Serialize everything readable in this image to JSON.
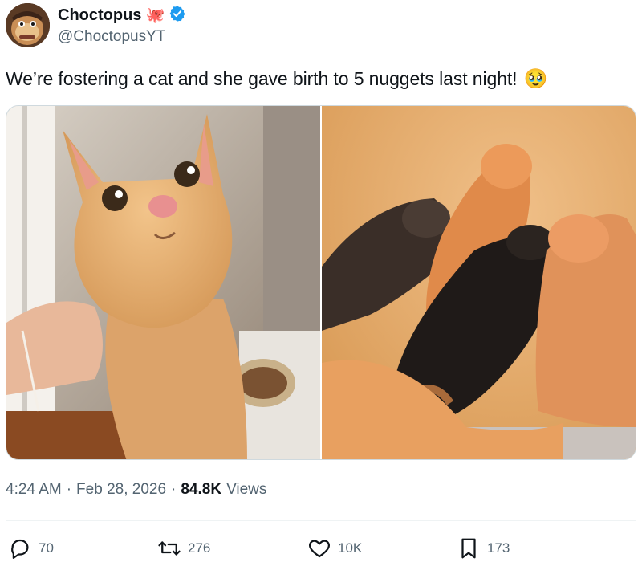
{
  "author": {
    "display_name": "Choctopus",
    "handle": "@ChoctopusYT",
    "octopus_emoji": "🐙",
    "verified_icon": "verified-badge-icon"
  },
  "tweet": {
    "text": "We’re fostering a cat and she gave birth to 5 nuggets last night!",
    "emoji": "🥹"
  },
  "media": {
    "photos": [
      "orange-cat-photo",
      "newborn-kittens-photo"
    ]
  },
  "meta": {
    "time": "4:24 AM",
    "separator": "·",
    "date": "Feb 28, 2026",
    "views_count": "84.8K",
    "views_label": "Views"
  },
  "actions": {
    "replies": "70",
    "reposts": "276",
    "likes": "10K",
    "bookmarks": "173"
  },
  "colors": {
    "text_primary": "#0f1419",
    "text_secondary": "#536471",
    "verified_blue": "#1d9bf0",
    "border": "#cfd9de"
  }
}
